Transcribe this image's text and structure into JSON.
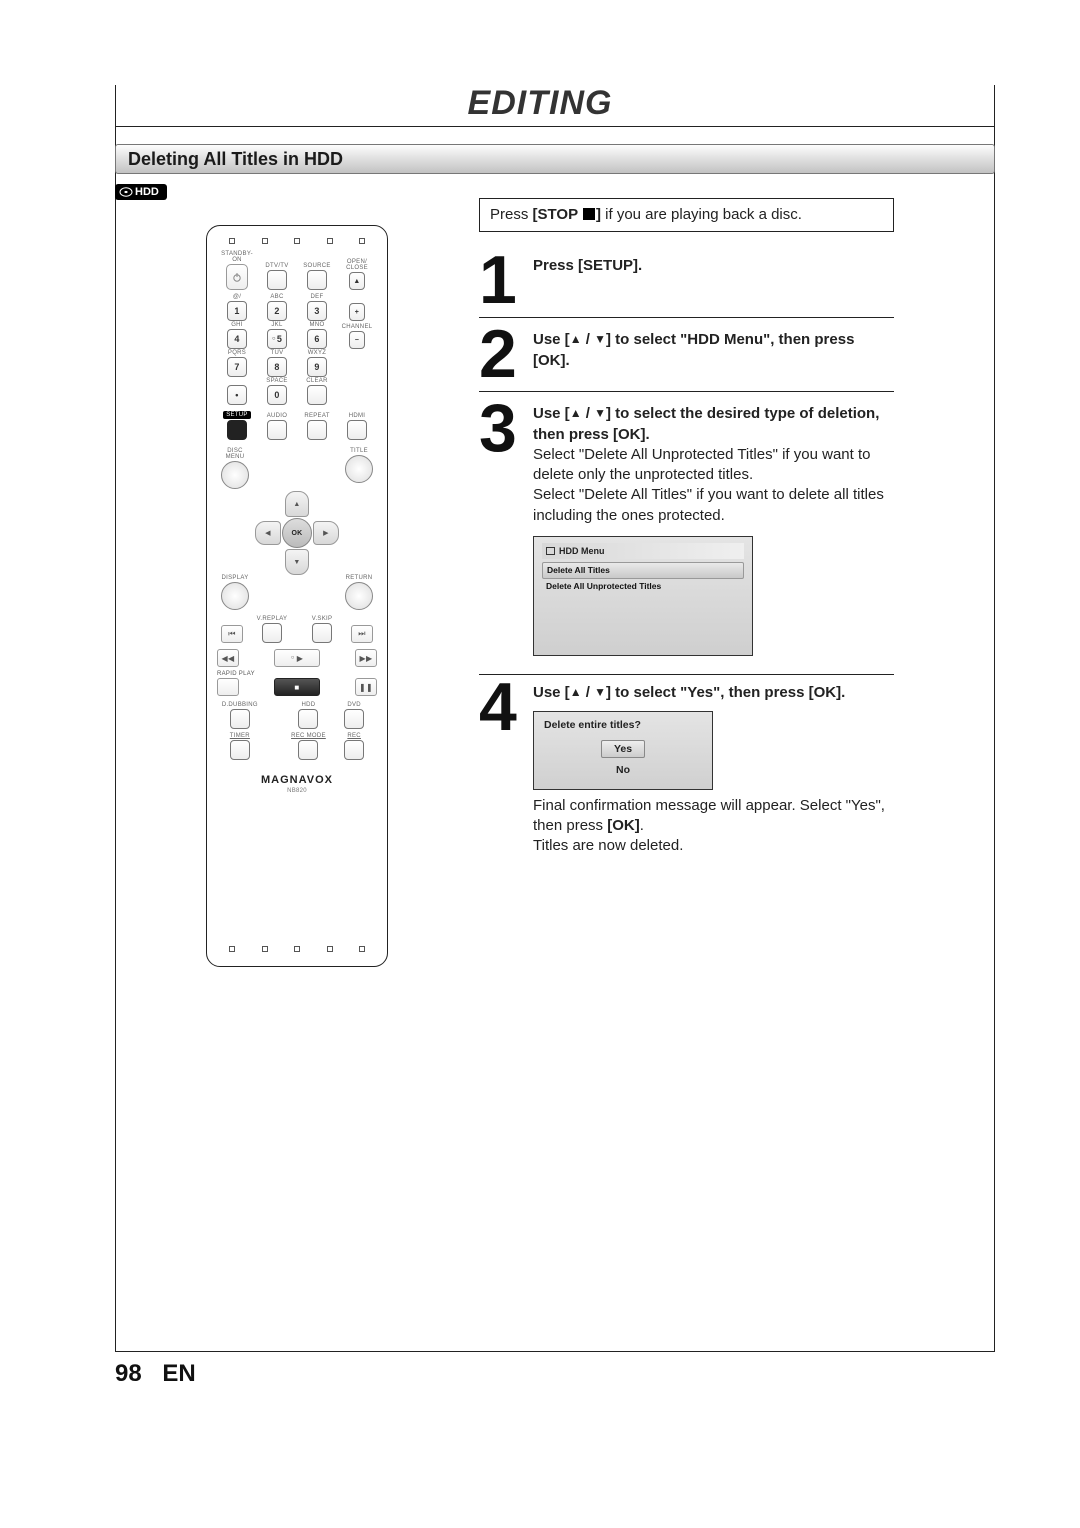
{
  "chapter": "EDITING",
  "section_title": "Deleting All Titles in HDD",
  "badge": {
    "label": "HDD"
  },
  "note": {
    "pre": "Press ",
    "button": "[STOP ",
    "button_close": "]",
    "post": " if you are playing back a disc."
  },
  "steps": [
    {
      "num": "1",
      "head": "Press [SETUP]."
    },
    {
      "num": "2",
      "head_pre": "Use [",
      "head_mid": " / ",
      "head_post": "] to select \"HDD Menu\", then press [OK]."
    },
    {
      "num": "3",
      "head_pre": "Use [",
      "head_mid": " / ",
      "head_post": "] to select the desired type of deletion, then press [OK].",
      "body1": "Select \"Delete All Unprotected Titles\" if you want to delete only the unprotected titles.",
      "body2": "Select \"Delete All Titles\" if you want to delete all titles including the ones protected."
    },
    {
      "num": "4",
      "head_pre": "Use [",
      "head_mid": " / ",
      "head_post": "] to select \"Yes\", then press [OK].",
      "body1_pre": "Final confirmation message will appear. Select \"Yes\", then press ",
      "body1_bold": "[OK]",
      "body1_post": ".",
      "body2": "Titles are now deleted."
    }
  ],
  "osd_menu": {
    "title": "HDD Menu",
    "items": [
      "Delete All Titles",
      "Delete All Unprotected Titles"
    ],
    "selected_index": 0
  },
  "dialog": {
    "question": "Delete entire titles?",
    "options": [
      "Yes",
      "No"
    ],
    "selected_index": 0
  },
  "remote": {
    "brand": "MAGNAVOX",
    "model": "NB820",
    "row1_labels": [
      "STANDBY-ON",
      "DTV/TV",
      "SOURCE",
      "OPEN/\nCLOSE"
    ],
    "numpad_labels": [
      "@/",
      "ABC",
      "DEF",
      "",
      "GHI",
      "JKL",
      "MNO",
      "CHANNEL",
      "PQRS",
      "TUV",
      "WXYZ",
      "",
      "",
      "SPACE",
      "CLEAR",
      ""
    ],
    "numpad_keys": [
      "1",
      "2",
      "3",
      "+",
      "4",
      "5",
      "6",
      "−",
      "7",
      "8",
      "9",
      "",
      "•",
      "0",
      "",
      ""
    ],
    "row_setup_labels": [
      "SETUP",
      "AUDIO",
      "REPEAT",
      "HDMI"
    ],
    "disc_title": {
      "left": "DISC MENU",
      "right": "TITLE"
    },
    "ok_label": "OK",
    "display_return": {
      "left": "DISPLAY",
      "right": "RETURN"
    },
    "vreplay_vskip": [
      "V.REPLAY",
      "V.SKIP"
    ],
    "rapid_play": "RAPID PLAY",
    "dubbing_labels": [
      "D.DUBBING",
      "",
      "HDD",
      "DVD"
    ],
    "bottom_labels": [
      "TIMER",
      "",
      "REC MODE",
      "REC"
    ]
  },
  "footer": {
    "page": "98",
    "lang": "EN"
  }
}
